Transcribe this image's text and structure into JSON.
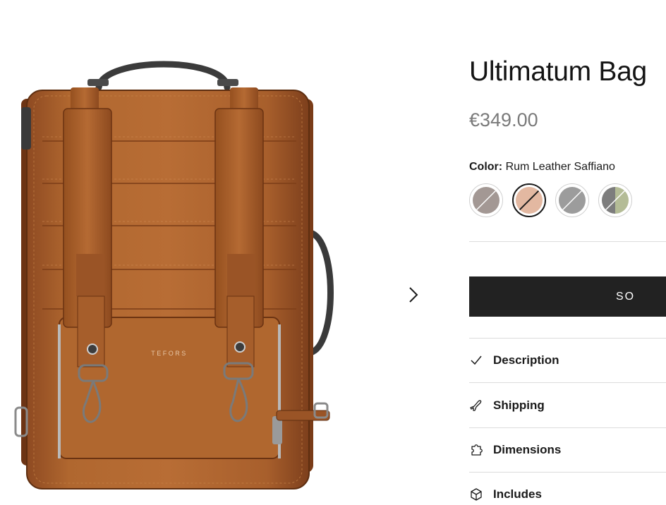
{
  "product": {
    "title": "Ultimatum Bag",
    "price": "€349.00",
    "image_alt": "brown leather backpack",
    "logo_text": "TEFORS"
  },
  "color": {
    "label": "Color:",
    "selected_value": "Rum Leather Saffiano",
    "swatches": [
      {
        "name": "taupe",
        "colors": [
          "#a39894",
          "#b3aba7"
        ],
        "selected": false
      },
      {
        "name": "rum",
        "colors": [
          "#e3b8a1",
          "#e3b8a1"
        ],
        "selected": true
      },
      {
        "name": "grey",
        "colors": [
          "#9c9c9c",
          "#a8a8a8"
        ],
        "selected": false
      },
      {
        "name": "grey-green",
        "colors": [
          "#7d7d7d",
          "#b4bc96"
        ],
        "selected": false
      }
    ]
  },
  "cta": {
    "label": "SOLD OUT",
    "visible_label": "SO"
  },
  "accordion": [
    {
      "label": "Description",
      "icon": "check-icon"
    },
    {
      "label": "Shipping",
      "icon": "plane-icon"
    },
    {
      "label": "Dimensions",
      "icon": "puzzle-icon"
    },
    {
      "label": "Includes",
      "icon": "box-icon"
    }
  ],
  "colors": {
    "cta_bg": "#222222",
    "price": "#7a7a7a",
    "leather": "#a9602e",
    "divider": "#dcdcdc"
  }
}
